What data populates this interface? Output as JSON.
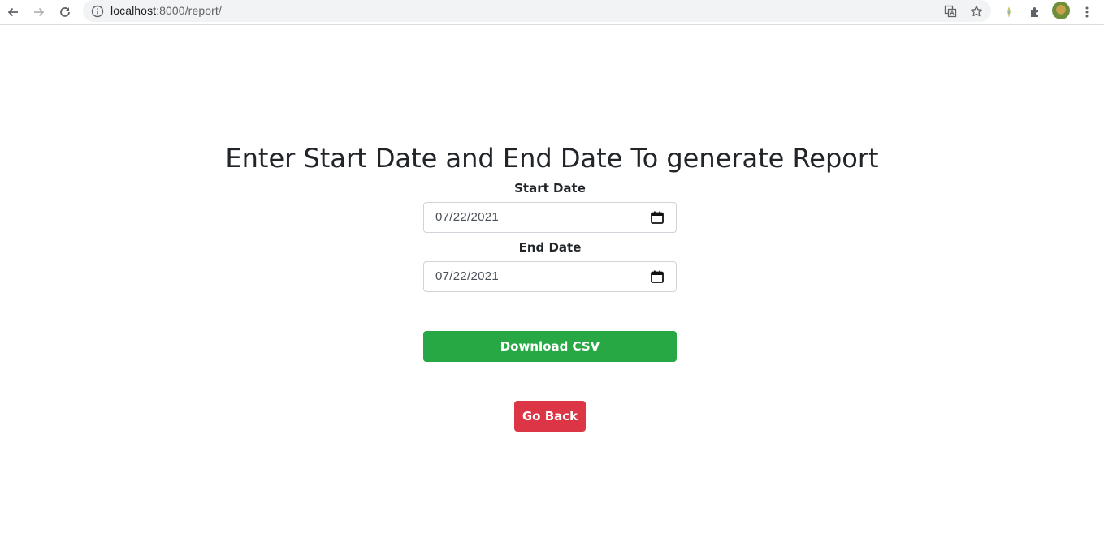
{
  "browser": {
    "url_host": "localhost",
    "url_path": ":8000/report/"
  },
  "page": {
    "title": "Enter Start Date and End Date To generate Report",
    "start_label": "Start Date",
    "start_value": "07/22/2021",
    "end_label": "End Date",
    "end_value": "07/22/2021",
    "download_label": "Download CSV",
    "back_label": "Go Back"
  },
  "icons": {
    "back": "back-arrow-icon",
    "forward": "forward-arrow-icon",
    "reload": "reload-icon",
    "info": "info-icon",
    "translate": "translate-icon",
    "bookmark": "star-icon",
    "extension": "puzzle-icon",
    "menu": "kebab-menu-icon",
    "calendar": "calendar-icon"
  },
  "colors": {
    "success": "#28a745",
    "danger": "#dc3545"
  }
}
